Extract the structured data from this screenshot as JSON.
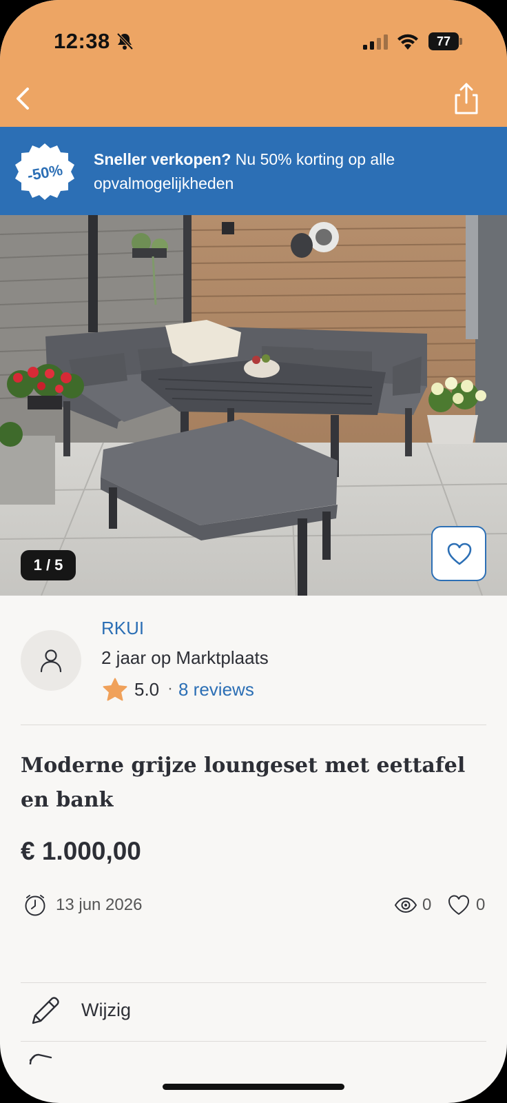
{
  "status_bar": {
    "time": "12:38",
    "battery": "77"
  },
  "promo": {
    "badge": "-50%",
    "bold_text": "Sneller verkopen?",
    "rest_text": " Nu 50% korting op alle opvalmogelijkheden"
  },
  "gallery": {
    "counter": "1 / 5"
  },
  "seller": {
    "name": "RKUI",
    "since": "2 jaar op Marktplaats",
    "rating": "5.0",
    "separator": "·",
    "reviews": "8 reviews"
  },
  "listing": {
    "title": "Moderne grijze loungeset met eettafel en bank",
    "price": "€ 1.000,00",
    "date": "13 jun 2026",
    "views": "0",
    "favorites": "0"
  },
  "actions": {
    "edit_label": "Wijzig"
  },
  "colors": {
    "header": "#eda564",
    "promo": "#2c6fb5",
    "link": "#2c6fb5",
    "star": "#f0a15a",
    "text": "#2d2f36"
  },
  "icons": [
    "bell-muted-icon",
    "signal-icon",
    "wifi-icon",
    "battery-icon",
    "back-icon",
    "share-icon",
    "heart-icon",
    "user-icon",
    "star-icon",
    "clock-icon",
    "eye-icon",
    "pencil-icon"
  ]
}
